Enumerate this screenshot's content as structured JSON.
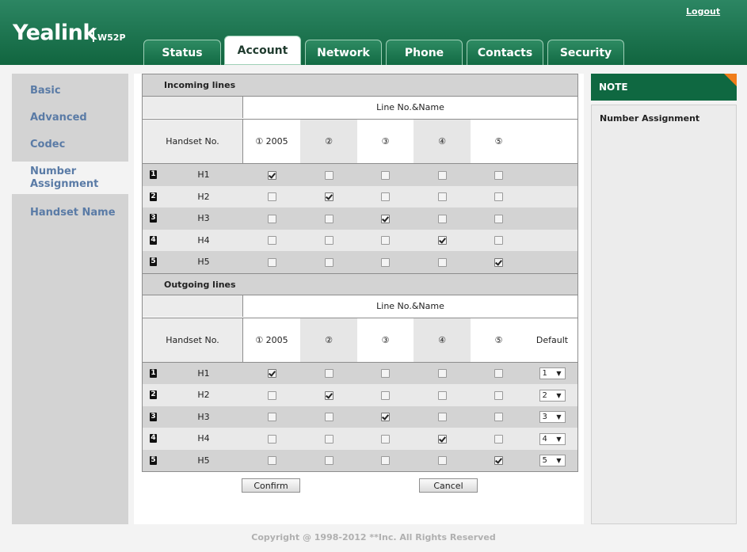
{
  "header": {
    "logo": "Yealink",
    "model": "W52P",
    "logout": "Logout",
    "tabs": [
      {
        "label": "Status",
        "active": false
      },
      {
        "label": "Account",
        "active": true
      },
      {
        "label": "Network",
        "active": false
      },
      {
        "label": "Phone",
        "active": false
      },
      {
        "label": "Contacts",
        "active": false
      },
      {
        "label": "Security",
        "active": false
      }
    ]
  },
  "sidebar": {
    "items": [
      {
        "label": "Basic",
        "active": false
      },
      {
        "label": "Advanced",
        "active": false
      },
      {
        "label": "Codec",
        "active": false
      },
      {
        "label": "Number Assignment",
        "active": true
      },
      {
        "label": "Handset Name",
        "active": false
      }
    ]
  },
  "incoming": {
    "title": "Incoming lines",
    "line_header": "Line No.&Name",
    "handset_header": "Handset No.",
    "lines": [
      "① 2005",
      "②",
      "③",
      "④",
      "⑤"
    ],
    "rows": [
      {
        "num": "1",
        "handset": "H1",
        "checked": [
          true,
          false,
          false,
          false,
          false
        ]
      },
      {
        "num": "2",
        "handset": "H2",
        "checked": [
          false,
          true,
          false,
          false,
          false
        ]
      },
      {
        "num": "3",
        "handset": "H3",
        "checked": [
          false,
          false,
          true,
          false,
          false
        ]
      },
      {
        "num": "4",
        "handset": "H4",
        "checked": [
          false,
          false,
          false,
          true,
          false
        ]
      },
      {
        "num": "5",
        "handset": "H5",
        "checked": [
          false,
          false,
          false,
          false,
          true
        ]
      }
    ]
  },
  "outgoing": {
    "title": "Outgoing lines",
    "line_header": "Line No.&Name",
    "handset_header": "Handset No.",
    "default_header": "Default",
    "lines": [
      "① 2005",
      "②",
      "③",
      "④",
      "⑤"
    ],
    "rows": [
      {
        "num": "1",
        "handset": "H1",
        "checked": [
          true,
          false,
          false,
          false,
          false
        ],
        "default": "1"
      },
      {
        "num": "2",
        "handset": "H2",
        "checked": [
          false,
          true,
          false,
          false,
          false
        ],
        "default": "2"
      },
      {
        "num": "3",
        "handset": "H3",
        "checked": [
          false,
          false,
          true,
          false,
          false
        ],
        "default": "3"
      },
      {
        "num": "4",
        "handset": "H4",
        "checked": [
          false,
          false,
          false,
          true,
          false
        ],
        "default": "4"
      },
      {
        "num": "5",
        "handset": "H5",
        "checked": [
          false,
          false,
          false,
          false,
          true
        ],
        "default": "5"
      }
    ]
  },
  "buttons": {
    "confirm": "Confirm",
    "cancel": "Cancel"
  },
  "note": {
    "title": "NOTE",
    "text": "Number Assignment"
  },
  "footer": "Copyright @ 1998-2012 **Inc. All Rights Reserved",
  "colors": {
    "header": "#11653f",
    "accent": "#f07d1a",
    "sidebar_text": "#5a7ba6"
  }
}
